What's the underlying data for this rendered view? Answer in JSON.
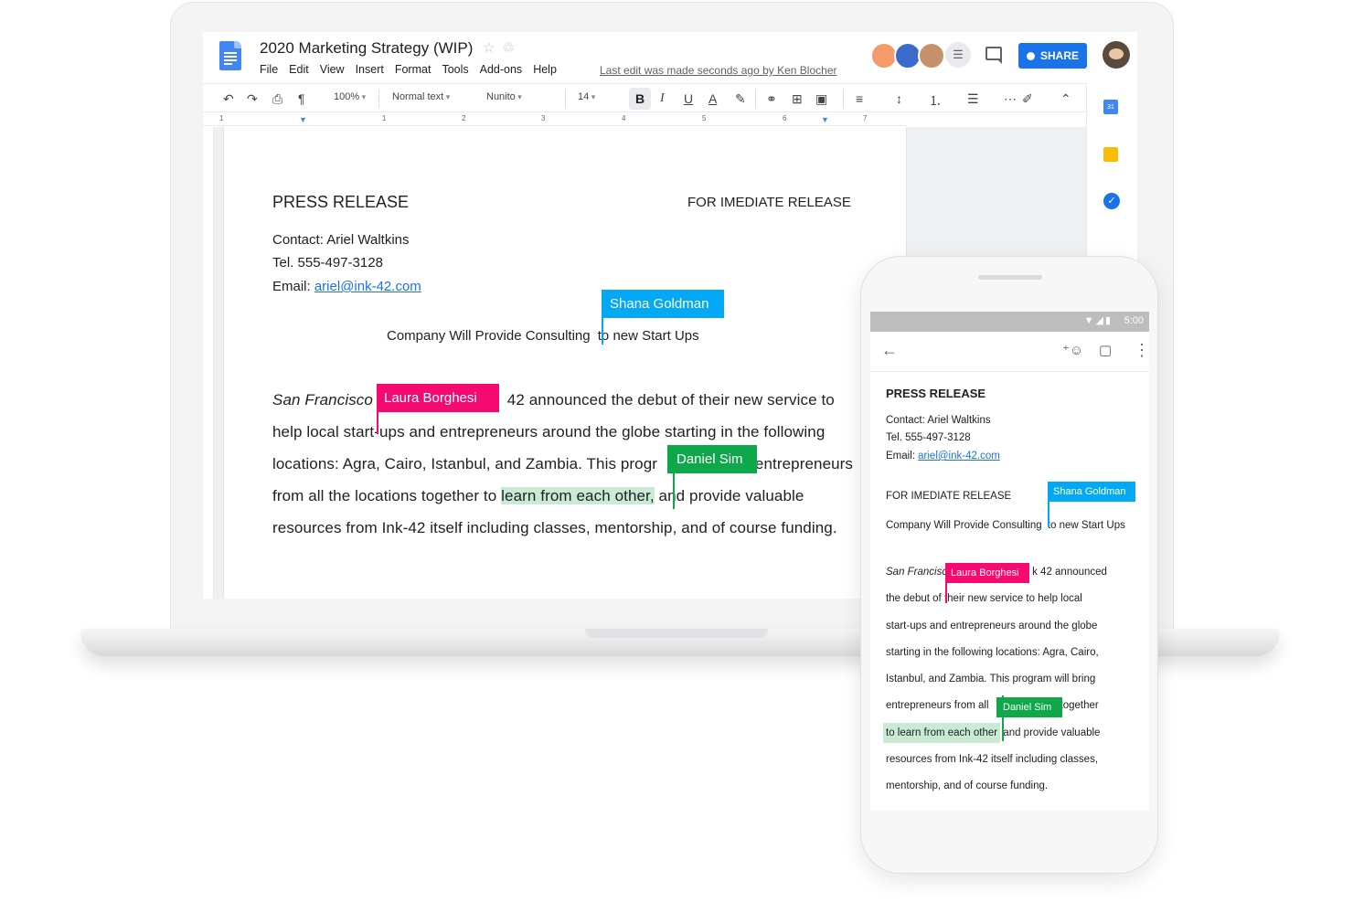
{
  "doc": {
    "title": "2020 Marketing Strategy (WIP)",
    "menu": [
      "File",
      "Edit",
      "View",
      "Insert",
      "Format",
      "Tools",
      "Add-ons",
      "Help"
    ],
    "last_edit": "Last edit was made seconds ago by Ken Blocher",
    "share_label": "SHARE",
    "more_collaborators": "☰"
  },
  "toolbar": {
    "zoom": "100%",
    "style": "Normal text",
    "font": "Nunito",
    "font_size": "14",
    "bold": "B",
    "italic": "I",
    "underline": "U",
    "text_color": "A"
  },
  "ruler": [
    "1",
    "1",
    "2",
    "3",
    "4",
    "5",
    "6",
    "7"
  ],
  "page": {
    "heading": "PRESS RELEASE",
    "release_tag": "FOR IMEDIATE RELEASE",
    "contact": "Contact: Ariel Waltkins",
    "tel": "Tel. 555-497-3128",
    "email_label": "Email: ",
    "email": "ariel@ink-42.com",
    "subtitle_a": "Company Will Provide Consulting",
    "subtitle_b": "to new Start Ups",
    "body": {
      "l1_italic": "San Francisco",
      "l1_rest": "42 announced the debut of their new service to",
      "l2": "help local start-ups and entrepreneurs around the globe starting in the following",
      "l3_a": "locations: Agra, Cairo, Istanbul, and Zambia. This progr",
      "l3_b": "entrepreneurs",
      "l4_a": "from all the locations together to ",
      "l4_hl": "learn from each other,",
      "l4_b": "and provide valuable",
      "l5": "resources from Ink-42 itself including classes, mentorship, and of course funding."
    }
  },
  "collaborators": {
    "shana": {
      "name": "Shana Goldman",
      "color": "#03a9f4"
    },
    "laura": {
      "name": "Laura Borghesi",
      "color": "#f50a72"
    },
    "daniel": {
      "name": "Daniel Sim",
      "color": "#0ea84a"
    }
  },
  "phone": {
    "time": "5:00",
    "status_icons": "▼◢▮",
    "heading": "PRESS RELEASE",
    "contact": "Contact: Ariel Waltkins",
    "tel": "Tel. 555-497-3128",
    "email_label": "Email: ",
    "email": "ariel@ink-42.com",
    "release_tag": "FOR IMEDIATE RELEASE",
    "subtitle_a": "Company Will Provide Consulting",
    "subtitle_b": "to new Start Ups",
    "l1_italic": "San Francisc",
    "l1_rest": "k 42 announced",
    "l2_a": "the debut of",
    "l2_b": "their new service to help local",
    "l3": "start-ups and entrepreneurs around the globe",
    "l4": "starting in the following locations: Agra, Cairo,",
    "l5": "Istanbul, and Zambia. This program will bring",
    "l6_a": "entrepreneurs from all",
    "l6_b": "together",
    "l7_hl": "to learn from each other",
    "l7_b": "and provide valuable",
    "l8": "resources from Ink-42 itself including classes,",
    "l9": "mentorship, and of course funding."
  }
}
